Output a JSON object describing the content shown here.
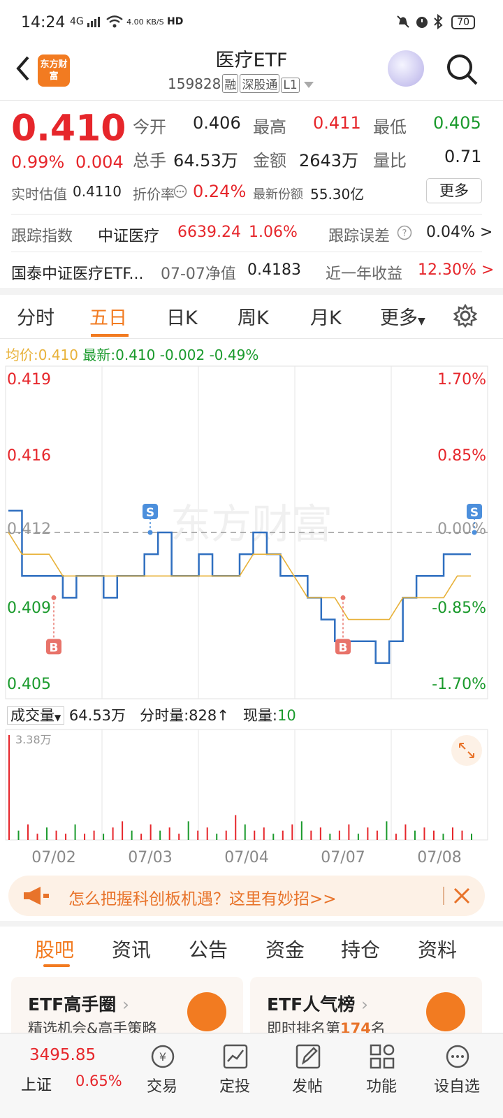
{
  "status_bar": {
    "time": "14:24",
    "network": "4G",
    "speed": "4.00 KB/S",
    "hd": "HD",
    "battery": "70"
  },
  "header": {
    "back_icon": "chevron-left-icon",
    "logo_text": "东方财富",
    "title": "医疗ETF",
    "code": "159828",
    "tags": [
      "融",
      "深股通",
      "L1"
    ],
    "search_icon": "search-icon"
  },
  "quote": {
    "price": "0.410",
    "change_pct": "0.99%",
    "change": "0.004",
    "open_label": "今开",
    "open": "0.406",
    "high_label": "最高",
    "high": "0.411",
    "low_label": "最低",
    "low": "0.405",
    "vol_label": "总手",
    "vol": "64.53万",
    "amount_label": "金额",
    "amount": "2643万",
    "ratio_label": "量比",
    "ratio": "0.71",
    "est_label": "实时估值",
    "est": "0.4110",
    "premium_label": "折价率",
    "premium": "0.24%",
    "shares_label": "最新份额",
    "shares": "55.30亿",
    "more_label": "更多"
  },
  "tracking": {
    "index_label": "跟踪指数",
    "index_name": "中证医疗",
    "index_value": "6639.24",
    "index_pct": "1.06%",
    "error_label": "跟踪误差",
    "error_value": "0.04% >",
    "fund_name": "国泰中证医疗ETF...",
    "nav_label": "07-07净值",
    "nav": "0.4183",
    "yearly_label": "近一年收益",
    "yearly": "12.30% >"
  },
  "chart_tabs": [
    "分时",
    "五日",
    "日K",
    "周K",
    "月K",
    "更多"
  ],
  "active_chart_tab": "五日",
  "chart_header": {
    "avg_label": "均价:",
    "avg": "0.410",
    "last_label": "最新:",
    "last": "0.410",
    "diff": "-0.002",
    "pct": "-0.49%"
  },
  "volume_header": {
    "selector": "成交量",
    "total": "64.53万",
    "min_label": "分时量:",
    "min_vol": "828",
    "now_label": "现量:",
    "now": "10"
  },
  "chart_data": {
    "type": "line",
    "title": "",
    "x": [
      "07/02",
      "07/03",
      "07/04",
      "07/07",
      "07/08"
    ],
    "y_left_ticks": [
      "0.419",
      "0.416",
      "0.412",
      "0.409",
      "0.405"
    ],
    "y_right_ticks": [
      "1.70%",
      "0.85%",
      "0.00%",
      "-0.85%",
      "-1.70%"
    ],
    "ylim": [
      0.405,
      0.419
    ],
    "reference": 0.412,
    "series": [
      {
        "values": [
          0.413,
          0.41,
          0.41,
          0.41,
          0.409,
          0.41,
          0.41,
          0.409,
          0.41,
          0.41,
          0.411,
          0.412,
          0.41,
          0.41,
          0.411,
          0.41,
          0.41,
          0.411,
          0.412,
          0.411,
          0.41,
          0.41,
          0.409,
          0.408,
          0.407,
          0.407,
          0.407,
          0.406,
          0.407,
          0.409,
          0.41,
          0.41,
          0.411,
          0.411,
          0.411
        ]
      },
      {
        "values": [
          0.412,
          0.411,
          0.411,
          0.411,
          0.41,
          0.41,
          0.41,
          0.41,
          0.41,
          0.41,
          0.41,
          0.41,
          0.41,
          0.41,
          0.41,
          0.41,
          0.41,
          0.41,
          0.411,
          0.411,
          0.411,
          0.41,
          0.409,
          0.409,
          0.409,
          0.408,
          0.408,
          0.408,
          0.408,
          0.409,
          0.409,
          0.409,
          0.409,
          0.41,
          0.41
        ]
      }
    ],
    "markers": [
      {
        "label": "B",
        "x": "07/02",
        "value": 0.409
      },
      {
        "label": "S",
        "x": "07/03",
        "value": 0.412
      },
      {
        "label": "B",
        "x": "07/07",
        "value": 0.409
      },
      {
        "label": "S",
        "x": "07/08",
        "value": 0.412
      }
    ],
    "volume_max_label": "3.38万",
    "volume": [
      33.8,
      3,
      5,
      2,
      4,
      3,
      2,
      5,
      2,
      3,
      2,
      4,
      6,
      3,
      2,
      5,
      3,
      4,
      2,
      6,
      3,
      4,
      2,
      3,
      8,
      5,
      3,
      4,
      2,
      3,
      5,
      6,
      3,
      4,
      2,
      3,
      5,
      2,
      4,
      3,
      6,
      2,
      5,
      3,
      4,
      3,
      2,
      4,
      3,
      2
    ],
    "colors": {
      "price": "#2f6fc0",
      "avg": "#e8b23a",
      "up": "#e6262b",
      "down": "#1a9a2c"
    }
  },
  "watermark": "东方财富",
  "banner": {
    "text": "怎么把握科创板机遇？这里有妙招>>"
  },
  "content_tabs": [
    "股吧",
    "资讯",
    "公告",
    "资金",
    "持仓",
    "资料"
  ],
  "active_content_tab": "股吧",
  "cards": [
    {
      "title": "ETF高手圈",
      "sub": "精选机会&高手策略"
    },
    {
      "title": "ETF人气榜",
      "sub_prefix": "即时排名第",
      "rank": "174",
      "sub_suffix": "名"
    }
  ],
  "bottom_nav": {
    "index_value": "3495.85",
    "index_name": "上证",
    "index_pct": "0.65%",
    "items": [
      "交易",
      "定投",
      "发帖",
      "功能",
      "设自选"
    ]
  }
}
